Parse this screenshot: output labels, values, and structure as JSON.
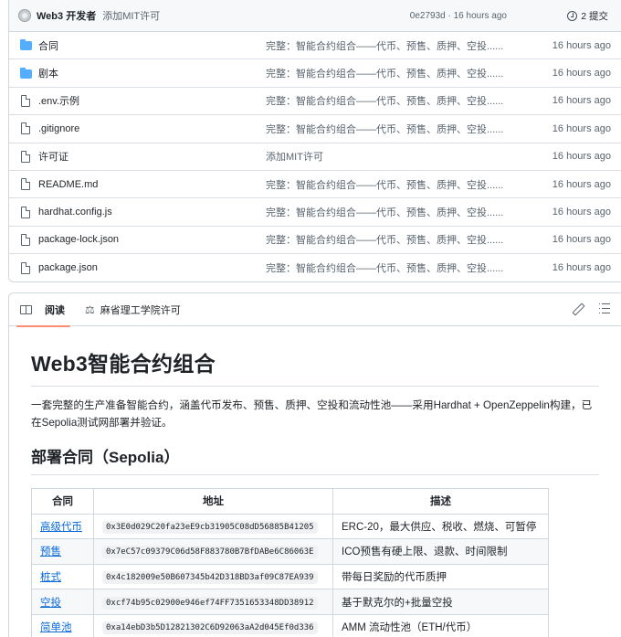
{
  "commit": {
    "author": "Web3 开发者",
    "message": "添加MIT许可",
    "meta": "0e2793d · 16 hours ago",
    "count_label": "2 提交"
  },
  "files": [
    {
      "type": "folder",
      "name": "合同",
      "commit": "完整：智能合约组合——代币、预售、质押、空投......",
      "time": "16 hours ago"
    },
    {
      "type": "folder",
      "name": "剧本",
      "commit": "完整：智能合约组合——代币、预售、质押、空投......",
      "time": "16 hours ago"
    },
    {
      "type": "file",
      "name": ".env.示例",
      "commit": "完整：智能合约组合——代币、预售、质押、空投......",
      "time": "16 hours ago"
    },
    {
      "type": "file",
      "name": ".gitignore",
      "commit": "完整：智能合约组合——代币、预售、质押、空投......",
      "time": "16 hours ago"
    },
    {
      "type": "file",
      "name": "许可证",
      "commit": "添加MIT许可",
      "time": "16 hours ago"
    },
    {
      "type": "file",
      "name": "README.md",
      "commit": "完整：智能合约组合——代币、预售、质押、空投......",
      "time": "16 hours ago"
    },
    {
      "type": "file",
      "name": "hardhat.config.js",
      "commit": "完整：智能合约组合——代币、预售、质押、空投......",
      "time": "16 hours ago"
    },
    {
      "type": "file",
      "name": "package-lock.json",
      "commit": "完整：智能合约组合——代币、预售、质押、空投......",
      "time": "16 hours ago"
    },
    {
      "type": "file",
      "name": "package.json",
      "commit": "完整：智能合约组合——代币、预售、质押、空投......",
      "time": "16 hours ago"
    }
  ],
  "readme": {
    "tabs": {
      "read": "阅读",
      "license": "麻省理工学院许可"
    },
    "title": "Web3智能合约组合",
    "description": "一套完整的生产准备智能合约，涵盖代币发布、预售、质押、空投和流动性池——采用Hardhat + OpenZeppelin构建，已在Sepolia测试网部署并验证。",
    "section_title": "部署合同（Sepolia）",
    "table": {
      "headers": [
        "合同",
        "地址",
        "描述"
      ],
      "rows": [
        {
          "name": "高级代币",
          "address": "0x3E0d029C20fa23eE9cb31905C08dD56885B41205",
          "desc": "ERC-20，最大供应、税收、燃烧、可暂停"
        },
        {
          "name": "预售",
          "address": "0x7eC57c09379C06d58F883780B7BfDABe6C86063E",
          "desc": "ICO预售有硬上限、退款、时间限制"
        },
        {
          "name": "桩式",
          "address": "0x4c182009e50B607345b42D318BD3af09C87EA939",
          "desc": "带每日奖励的代币质押"
        },
        {
          "name": "空投",
          "address": "0xcf74b95c02900e946ef74FF7351653348DD38912",
          "desc": "基于默克尔的+批量空投"
        },
        {
          "name": "简单池",
          "address": "0xa14ebD3b5D12821302C6D92063aA2d045Ef0d336",
          "desc": "AMM 流动性池（ETH/代币）"
        }
      ]
    }
  }
}
